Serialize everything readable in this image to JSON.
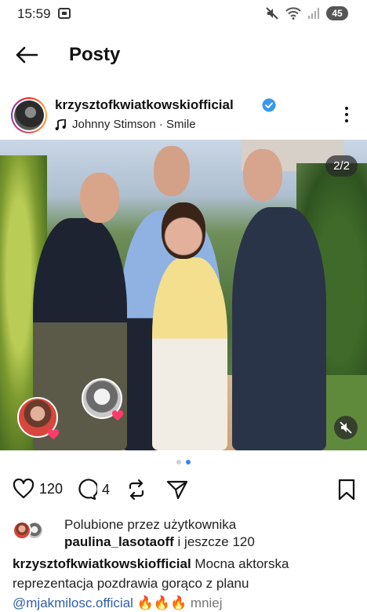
{
  "status_bar": {
    "time": "15:59",
    "battery": "45"
  },
  "header": {
    "title": "Posty"
  },
  "post": {
    "username": "krzysztofkwiatkowskiofficial",
    "music": "Johnny Stimson · Smile",
    "counter": "2/2",
    "likes": "120",
    "comments": "4",
    "liked_by_prefix": "Polubione przez użytkownika",
    "liked_by_user": "paulina_lasotaoff",
    "liked_by_suffix": "i jeszcze 120",
    "caption_user": "krzysztofkwiatkowskiofficial",
    "caption_text": "Mocna aktorska reprezentacja pozdrawia gorąco z planu",
    "caption_mention": "@mjakmilosc.official",
    "caption_emoji": "🔥🔥🔥",
    "caption_more": "mniej"
  },
  "colors": {
    "accent": "#3b82f6",
    "mention": "#2f5fa8",
    "verified": "#3897f0"
  },
  "icons": [
    "screenshot-icon",
    "mute-icon",
    "wifi-icon",
    "signal-icon",
    "back-arrow-icon",
    "verified-icon",
    "music-note-icon",
    "more-icon",
    "sound-off-icon",
    "heart-icon",
    "comment-icon",
    "repost-icon",
    "share-icon",
    "bookmark-icon"
  ]
}
